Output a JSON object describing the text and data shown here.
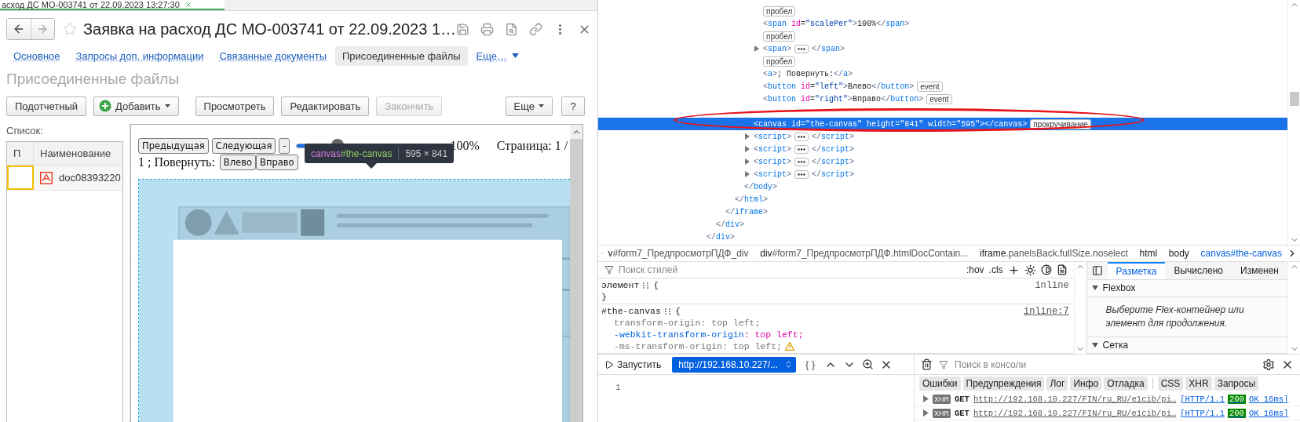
{
  "browser_tab": {
    "title": "асход ДС МО-003741 от 22.09.2023 13:27:30"
  },
  "form": {
    "title": "Заявка на расход ДС МО-003741 от 22.09.2023 1…",
    "tabs": [
      {
        "label": "Основное",
        "kind": "link",
        "selected": false
      },
      {
        "label": "Запросы доп. информации",
        "kind": "link",
        "selected": false
      },
      {
        "label": "Связанные документы",
        "kind": "link",
        "selected": false
      },
      {
        "label": "Присоединенные файлы",
        "kind": "link",
        "selected": true
      },
      {
        "label": "Еще…",
        "kind": "more",
        "selected": false
      }
    ],
    "section_title": "Присоединенные файлы",
    "toolbar": [
      {
        "label": "Подотчетный",
        "kind": "button",
        "disabled": false
      },
      {
        "label": "Добавить",
        "kind": "add",
        "disabled": false
      },
      {
        "label": "Просмотреть",
        "kind": "button",
        "disabled": false
      },
      {
        "label": "Редактировать",
        "kind": "button",
        "disabled": false
      },
      {
        "label": "Закончить",
        "kind": "button",
        "disabled": true
      },
      {
        "label": "Еще",
        "kind": "menu",
        "disabled": false
      },
      {
        "label": "?",
        "kind": "help",
        "disabled": false
      }
    ],
    "list_label": "Список:",
    "table": {
      "columns": [
        "П",
        "Наименование"
      ],
      "rows": [
        {
          "name": "doc08393220",
          "selected": true
        }
      ]
    }
  },
  "preview": {
    "buttons": [
      "Предыдущая",
      "Следующая",
      "-"
    ],
    "zoom_slider": {
      "level": 0.33
    },
    "scale": "100%",
    "page": "Страница: 1 /",
    "page_cont": "1 ; Повернуть:",
    "rotate_buttons": [
      "Влево",
      "Вправо"
    ],
    "tooltip": {
      "tag": "canvas",
      "id": "#the-canvas",
      "size": "595 × 841"
    }
  },
  "devtools": {
    "dom_tree": [
      {
        "close": "</div>",
        "selected": false,
        "children": [
          {
            "close": "</div>",
            "selected": false,
            "children": [
              {
                "close": "</iframe>",
                "selected": false,
                "children": [
                  {
                    "close": "</html>",
                    "selected": false,
                    "children": [
                      {
                        "close": "</body>",
                        "selected": false,
                        "children": [
                          {
                            "selected": false,
                            "children": [
                              {
                                "kind": "whitespace",
                                "badge": "пробел",
                                "selected": false
                              },
                              {
                                "kind": "element",
                                "markup": "<span id=\"scalePer\">100%</span>",
                                "selected": false
                              },
                              {
                                "kind": "whitespace",
                                "badge": "пробел",
                                "selected": false
                              },
                              {
                                "kind": "element",
                                "markup": "<span>",
                                "tail": "</span>",
                                "expanded": false,
                                "selected": false
                              },
                              {
                                "kind": "whitespace",
                                "badge": "пробел",
                                "selected": false
                              },
                              {
                                "kind": "element",
                                "markup": "<a>; Повернуть:</a>",
                                "selected": false
                              },
                              {
                                "kind": "element",
                                "markup": "<button id=\"left\">Влево</button>",
                                "badge": "event",
                                "selected": false
                              },
                              {
                                "kind": "element",
                                "markup": "<button id=\"right\">Вправо</button>",
                                "badge": "event",
                                "selected": false
                              }
                            ]
                          },
                          {
                            "kind": "element",
                            "markup": "<canvas id=\"the-canvas\" height=\"841\" width=\"595\"></canvas>",
                            "badge": "прокручивание",
                            "selected": true
                          },
                          {
                            "kind": "element",
                            "markup": "<script>",
                            "tail": "</script>",
                            "expanded": false,
                            "selected": false
                          },
                          {
                            "kind": "element",
                            "markup": "<script>",
                            "tail": "</script>",
                            "expanded": false,
                            "selected": false
                          },
                          {
                            "kind": "element",
                            "markup": "<script>",
                            "tail": "</script>",
                            "expanded": false,
                            "selected": false
                          },
                          {
                            "kind": "element",
                            "markup": "<script>",
                            "tail": "</script>",
                            "expanded": false,
                            "selected": false
                          }
                        ]
                      }
                    ]
                  }
                ]
              }
            ]
          }
        ]
      }
    ],
    "breadcrumbs": [
      {
        "tag": "v",
        "rest": "#form7_ПредпросмотрПДФ_div",
        "selected": false
      },
      {
        "tag": "div",
        "rest": "#form7_ПредпросмотрПДФ.htmlDocContain...",
        "selected": false
      },
      {
        "tag": "iframe",
        "rest": ".panelsBack.fullSize.noselect",
        "selected": false
      },
      {
        "tag": "html",
        "selected": false
      },
      {
        "tag": "body",
        "selected": false
      },
      {
        "tag": "canvas",
        "rest": "#the-canvas",
        "selected": true
      }
    ],
    "styles": {
      "filter_placeholder": "Поиск стилей",
      "pseudo": ":hov",
      "classes": ".cls",
      "rules": [
        {
          "selector": "элемент",
          "open": "{",
          "close": "}",
          "source": "inline"
        },
        {
          "selector": "#the-canvas",
          "open": "{",
          "source": "inline:7",
          "declarations": [
            {
              "text": "transform-origin: top left;",
              "overridden": true,
              "warning": false
            },
            {
              "text": "-webkit-transform-origin: top left;",
              "overridden": false,
              "warning": false
            },
            {
              "text": "-ms-transform-origin: top left;",
              "overridden": true,
              "warning": true
            }
          ]
        }
      ]
    },
    "layout": {
      "tabs": [
        {
          "label": "Разметка",
          "selected": true
        },
        {
          "label": "Вычислено",
          "selected": false
        },
        {
          "label": "Изменен",
          "selected": false
        }
      ],
      "sections": [
        {
          "title": "Flexbox",
          "expanded": true,
          "text": "Выберите Flex-контейнер или элемент для продолжения."
        },
        {
          "title": "Сетка",
          "expanded": true
        }
      ]
    },
    "editor": {
      "run": "Запустить",
      "url": "http://192.168.10.227/...",
      "pretty": "{ }",
      "line": "1"
    },
    "console": {
      "filter_placeholder": "Поиск в консоли",
      "filters": [
        {
          "label": "Ошибки",
          "selected": true
        },
        {
          "label": "Предупреждения",
          "selected": true
        },
        {
          "label": "Лог",
          "selected": true
        },
        {
          "label": "Инфо",
          "selected": true
        },
        {
          "label": "Отладка",
          "selected": true
        },
        {
          "label": "CSS",
          "selected": true
        },
        {
          "label": "XHR",
          "selected": true
        },
        {
          "label": "Запросы",
          "selected": true
        }
      ],
      "logs": [
        {
          "type": "XHR",
          "method": "GET",
          "url": "http://192.168.10.227/FIN/ru_RU/e1cib/pi…",
          "protocol": "[HTTP/1.1",
          "status": "200",
          "result": "OK 16ms]",
          "expanded": false
        },
        {
          "type": "XHR",
          "method": "GET",
          "url": "http://192.168.10.227/FIN/ru_RU/e1cib/pi…",
          "protocol": "[HTTP/1.1",
          "status": "200",
          "result": "OK 16ms]",
          "expanded": false
        }
      ]
    }
  }
}
